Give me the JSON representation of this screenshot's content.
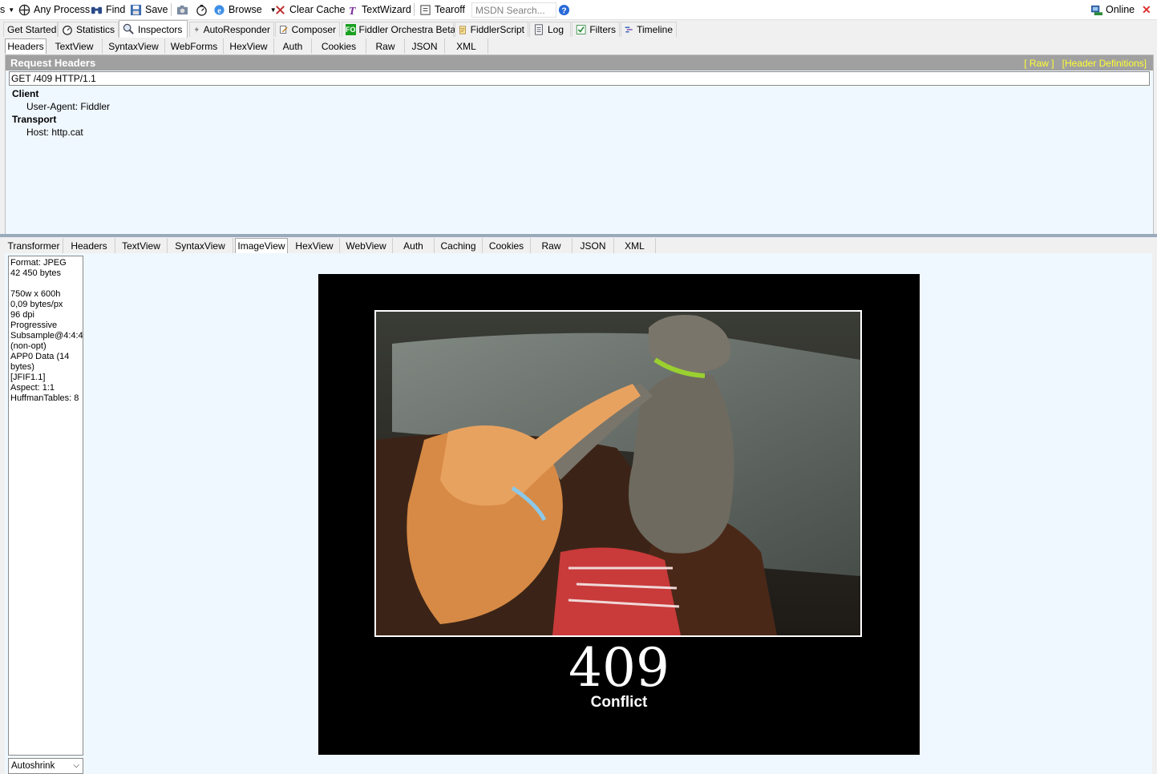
{
  "toolbar": {
    "edge_label": "s",
    "any_process": "Any Process",
    "find": "Find",
    "save": "Save",
    "browse": "Browse",
    "clear_cache": "Clear Cache",
    "textwizard": "TextWizard",
    "tearoff": "Tearoff",
    "msdn_search": "MSDN Search...",
    "online": "Online"
  },
  "main_tabs": [
    "Get Started",
    "Statistics",
    "Inspectors",
    "AutoResponder",
    "Composer",
    "Fiddler Orchestra Beta",
    "FiddlerScript",
    "Log",
    "Filters",
    "Timeline"
  ],
  "main_tab_badges": {
    "orchestra": "FO"
  },
  "request_tabs": [
    "Headers",
    "TextView",
    "SyntaxView",
    "WebForms",
    "HexView",
    "Auth",
    "Cookies",
    "Raw",
    "JSON",
    "XML"
  ],
  "request": {
    "title": "Request Headers",
    "links": "[ Raw ]   [Header Definitions]",
    "request_line": "GET /409 HTTP/1.1",
    "groups": [
      {
        "name": "Client",
        "headers": [
          "User-Agent: Fiddler"
        ]
      },
      {
        "name": "Transport",
        "headers": [
          "Host: http.cat"
        ]
      }
    ]
  },
  "response_tabs": [
    "Transformer",
    "Headers",
    "TextView",
    "SyntaxView",
    "ImageView",
    "HexView",
    "WebView",
    "Auth",
    "Caching",
    "Cookies",
    "Raw",
    "JSON",
    "XML"
  ],
  "image_info": {
    "lines": [
      "Format: JPEG",
      "42 450 bytes",
      "",
      "750w x 600h",
      "0,09 bytes/px",
      "96 dpi",
      "Progressive",
      "Subsample@4:4:4",
      "(non-opt)",
      "APP0 Data (14",
      "bytes)",
      "[JFIF1.1]",
      "Aspect: 1:1",
      "HuffmanTables: 8"
    ]
  },
  "autoshrink": "Autoshrink",
  "poster": {
    "code": "409",
    "text": "Conflict"
  },
  "colors": {
    "panel_bg": "#f0f8ff",
    "header_bar": "#a0a0a0",
    "link_yellow": "#ffff33",
    "close_red": "#e03030"
  }
}
